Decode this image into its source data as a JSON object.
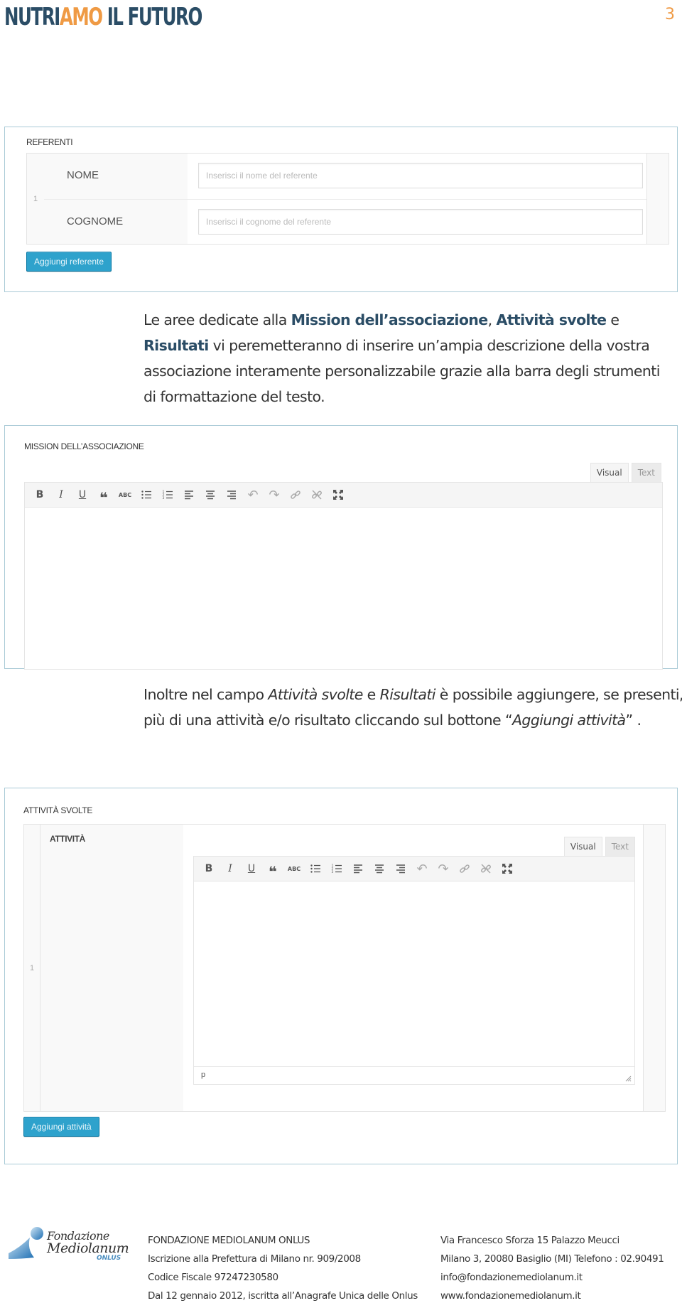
{
  "header": {
    "logo_part1": "NUTRI",
    "logo_accent": "AMO",
    "logo_part2": " IL FUTURO",
    "page_number": "3",
    "colors": {
      "brand_dark": "#2b4d66",
      "brand_accent": "#ef9a44"
    }
  },
  "referenti": {
    "title": "REFERENTI",
    "row_index": "1",
    "nome_label": "NOME",
    "nome_placeholder": "Inserisci il nome del referente",
    "nome_value": "",
    "cognome_label": "COGNOME",
    "cognome_placeholder": "Inserisci il cognome del referente",
    "cognome_value": "",
    "add_button": "Aggiungi referente"
  },
  "paragraph1": {
    "t1": "Le aree dedicate alla ",
    "b1": "Mission dell’associazione",
    "t2": ", ",
    "b2": "Attività svolte",
    "t3": " e ",
    "b3": "Risultati",
    "t4": " vi peremetteranno di inserire un’ampia descrizione della vostra associazione interamente personalizzabile grazie alla barra degli strumenti di formattazione del testo."
  },
  "mission": {
    "title": "MISSION DELL’ASSOCIAZIONE",
    "tab_visual": "Visual",
    "tab_text": "Text",
    "content": ""
  },
  "toolbar": {
    "buttons": [
      {
        "name": "bold",
        "glyph": "B"
      },
      {
        "name": "italic",
        "glyph": "I"
      },
      {
        "name": "underline",
        "glyph": "U"
      },
      {
        "name": "blockquote",
        "glyph": "❝"
      },
      {
        "name": "strikethrough",
        "glyph": "ABC"
      },
      {
        "name": "bulleted-list",
        "glyph": ""
      },
      {
        "name": "numbered-list",
        "glyph": ""
      },
      {
        "name": "align-left",
        "glyph": ""
      },
      {
        "name": "align-center",
        "glyph": ""
      },
      {
        "name": "align-right",
        "glyph": ""
      },
      {
        "name": "undo",
        "glyph": "↶"
      },
      {
        "name": "redo",
        "glyph": "↷"
      },
      {
        "name": "insert-link",
        "glyph": ""
      },
      {
        "name": "remove-link",
        "glyph": ""
      },
      {
        "name": "fullscreen",
        "glyph": ""
      }
    ]
  },
  "paragraph2": {
    "t1": "Inoltre nel campo ",
    "i1": "Attività svolte",
    "t2": " e ",
    "i2": "Risultati",
    "t3": "  è possibile aggiungere, se presenti,  più di una attività e/o risultato cliccando sul bottone “",
    "i3": "Aggiungi attività",
    "t4": "” ."
  },
  "attivita": {
    "title": "ATTIVITÀ SVOLTE",
    "row_index": "1",
    "field_label": "ATTIVITÀ",
    "tab_visual": "Visual",
    "tab_text": "Text",
    "content": "",
    "status_path": "p",
    "add_button": "Aggiungi attività"
  },
  "footer": {
    "logo_line1": "Fondazione",
    "logo_line2": "Mediolanum",
    "logo_line3": "ONLUS",
    "col1": [
      "FONDAZIONE MEDIOLANUM ONLUS",
      "Iscrizione alla Prefettura di Milano nr. 909/2008",
      "Codice Fiscale 97247230580",
      "Dal 12 gennaio 2012, iscritta all’Anagrafe Unica delle Onlus"
    ],
    "col2": [
      "Via Francesco Sforza 15 Palazzo Meucci",
      "Milano 3, 20080 Basiglio (MI) Telefono : 02.90491",
      "info@fondazionemediolanum.it",
      "www.fondazionemediolanum.it"
    ]
  }
}
